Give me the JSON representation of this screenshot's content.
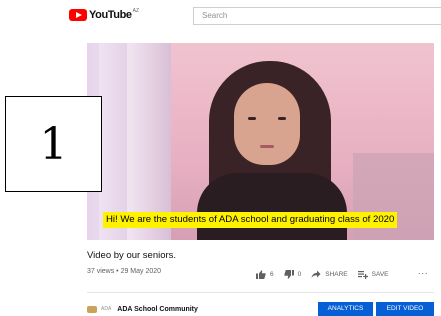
{
  "header": {
    "logo_text": "YouTube",
    "country_code": "AZ",
    "search_placeholder": "Search"
  },
  "player": {
    "subtitle": "Hi! We are the students of ADA school and graduating class of 2020"
  },
  "overlay": {
    "label": "1"
  },
  "video": {
    "title": "Video by our seniors.",
    "meta": "37 views • 29 May 2020",
    "likes": "6",
    "dislikes": "0",
    "share_label": "SHARE",
    "save_label": "SAVE",
    "more_label": "..."
  },
  "channel": {
    "avatar_text": "ADA",
    "name": "ADA School Community",
    "button1_label": "ANALYTICS",
    "button2_label": "EDIT VIDEO"
  },
  "colors": {
    "brand_red": "#ff0000",
    "accent_blue": "#065fd4",
    "subtitle_bg": "#fff200"
  }
}
